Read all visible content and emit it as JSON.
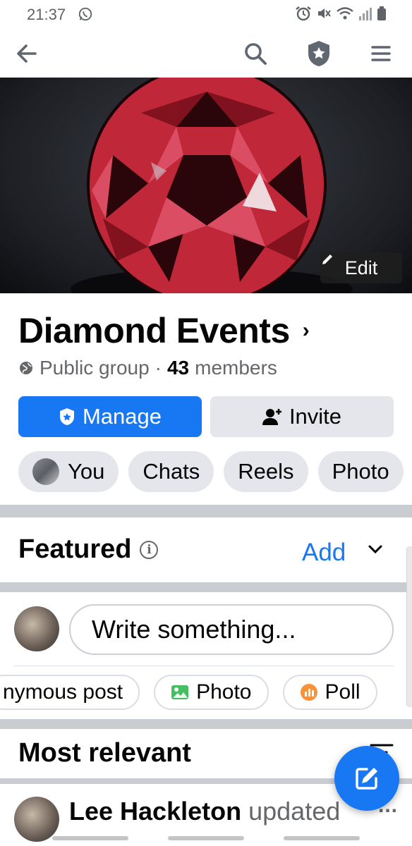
{
  "status_bar": {
    "time": "21:37"
  },
  "top_nav": {
    "back_icon": "arrow-left-icon",
    "search_icon": "search-icon",
    "admin_icon": "shield-star-icon",
    "menu_icon": "hamburger-icon"
  },
  "cover": {
    "edit_label": "Edit"
  },
  "group": {
    "name": "Diamond Events",
    "privacy": "Public group",
    "separator": "·",
    "member_count": "43",
    "members_label": "members"
  },
  "actions": {
    "manage_label": "Manage",
    "invite_label": "Invite"
  },
  "chips": [
    "You",
    "Chats",
    "Reels",
    "Photo"
  ],
  "featured": {
    "title": "Featured",
    "info_glyph": "i",
    "add_label": "Add"
  },
  "composer": {
    "placeholder": "Write something..."
  },
  "post_types": {
    "anonymous": "nymous post",
    "photo": "Photo",
    "poll": "Poll"
  },
  "feed": {
    "sort_title": "Most relevant",
    "post_author": "Lee Hackleton",
    "post_action": "updated",
    "more_glyph": "..."
  },
  "colors": {
    "brand_blue": "#1877f2",
    "chip_gray": "#e4e6eb",
    "muted_text": "#65676b"
  }
}
